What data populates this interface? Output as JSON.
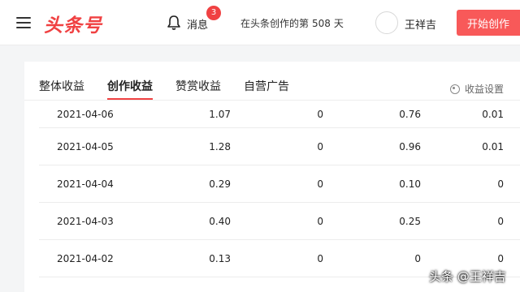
{
  "header": {
    "logo": "头条号",
    "notify_label": "消息",
    "notify_count": "3",
    "creator_days_prefix": "在头条创作的第",
    "creator_days": "508",
    "creator_days_suffix": "天",
    "username": "王祥吉",
    "start_button": "开始创作"
  },
  "tabs": [
    {
      "label": "整体收益"
    },
    {
      "label": "创作收益"
    },
    {
      "label": "赞赏收益"
    },
    {
      "label": "自营广告"
    }
  ],
  "active_tab": "创作收益",
  "settings_label": "收益设置",
  "table": {
    "rows": [
      {
        "date": "2021-04-06",
        "total": "1.07",
        "a": "0",
        "b": "0.76",
        "c": "0.01"
      },
      {
        "date": "2021-04-05",
        "total": "1.28",
        "a": "0",
        "b": "0.96",
        "c": "0.01"
      },
      {
        "date": "2021-04-04",
        "total": "0.29",
        "a": "0",
        "b": "0.10",
        "c": "0"
      },
      {
        "date": "2021-04-03",
        "total": "0.40",
        "a": "0",
        "b": "0.25",
        "c": "0"
      },
      {
        "date": "2021-04-02",
        "total": "0.13",
        "a": "0",
        "b": "0",
        "c": "0"
      }
    ]
  },
  "watermark": "头条 @王祥吉",
  "colors": {
    "brand": "#f04142",
    "button": "#f85959"
  },
  "icons": [
    "menu-icon",
    "bell-icon",
    "gear-icon"
  ]
}
